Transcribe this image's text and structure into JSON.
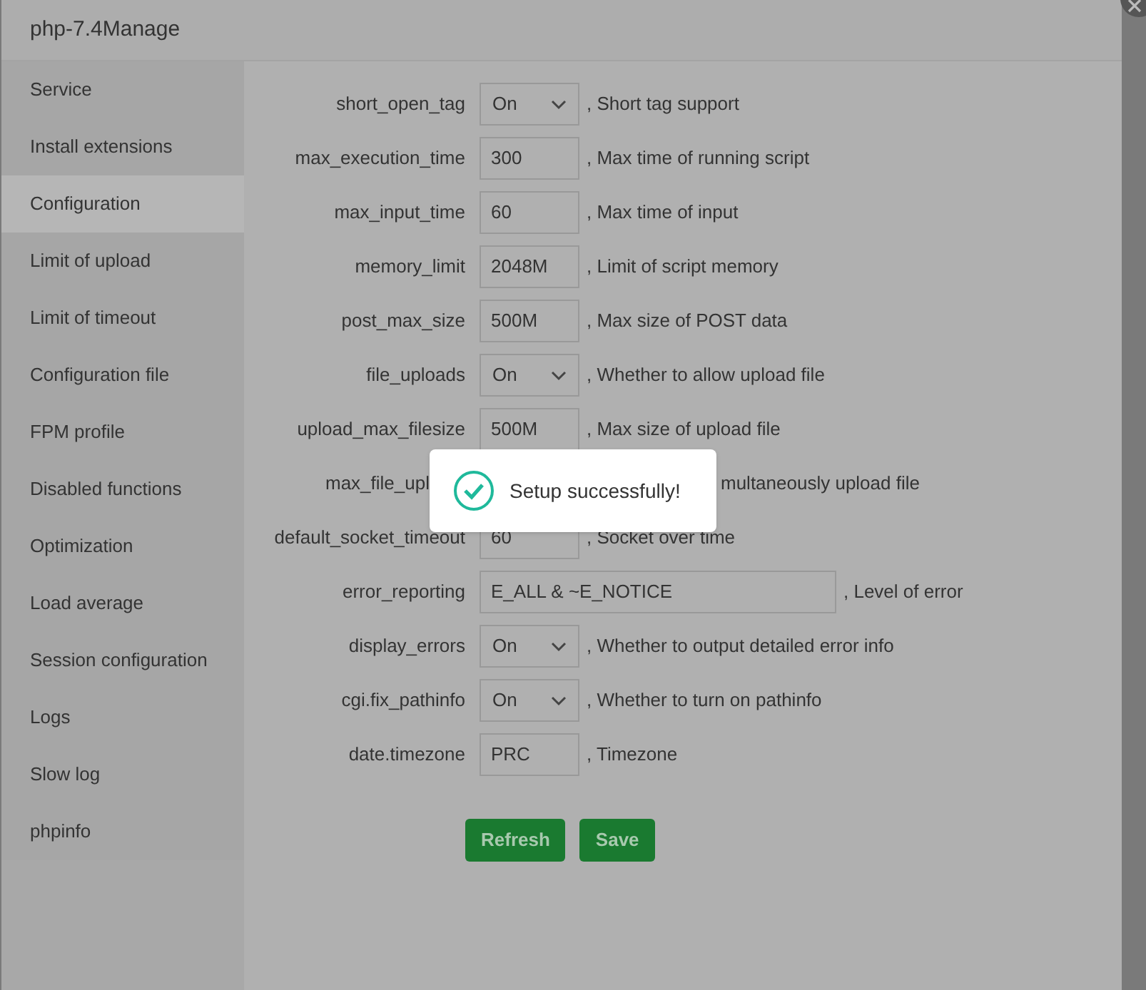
{
  "window": {
    "title": "php-7.4Manage"
  },
  "sidebar": {
    "items": [
      {
        "label": "Service",
        "selected": false
      },
      {
        "label": "Install extensions",
        "selected": false
      },
      {
        "label": "Configuration",
        "selected": true
      },
      {
        "label": "Limit of upload",
        "selected": false
      },
      {
        "label": "Limit of timeout",
        "selected": false
      },
      {
        "label": "Configuration file",
        "selected": false
      },
      {
        "label": "FPM profile",
        "selected": false
      },
      {
        "label": "Disabled functions",
        "selected": false
      },
      {
        "label": "Optimization",
        "selected": false
      },
      {
        "label": "Load average",
        "selected": false
      },
      {
        "label": "Session configuration",
        "selected": false
      },
      {
        "label": "Logs",
        "selected": false
      },
      {
        "label": "Slow log",
        "selected": false
      },
      {
        "label": "phpinfo",
        "selected": false
      }
    ]
  },
  "settings": [
    {
      "kind": "select",
      "label": "short_open_tag",
      "value": "On",
      "hint": ", Short tag support"
    },
    {
      "kind": "input",
      "label": "max_execution_time",
      "value": "300",
      "hint": ", Max time of running script"
    },
    {
      "kind": "input",
      "label": "max_input_time",
      "value": "60",
      "hint": ", Max time of input"
    },
    {
      "kind": "input",
      "label": "memory_limit",
      "value": "2048M",
      "hint": ", Limit of script memory"
    },
    {
      "kind": "input",
      "label": "post_max_size",
      "value": "500M",
      "hint": ", Max size of POST data"
    },
    {
      "kind": "select",
      "label": "file_uploads",
      "value": "On",
      "hint": ", Whether to allow upload file"
    },
    {
      "kind": "input",
      "label": "upload_max_filesize",
      "value": "500M",
      "hint": ", Max size of upload file"
    },
    {
      "kind": "covered",
      "label": "max_file_upl",
      "hint": "multaneously upload file"
    },
    {
      "kind": "input",
      "label": "default_socket_timeout",
      "value": "60",
      "hint": ", Socket over time"
    },
    {
      "kind": "wide",
      "label": "error_reporting",
      "value": "E_ALL & ~E_NOTICE",
      "hint": ", Level of error"
    },
    {
      "kind": "select",
      "label": "display_errors",
      "value": "On",
      "hint": ", Whether to output detailed error info"
    },
    {
      "kind": "select",
      "label": "cgi.fix_pathinfo",
      "value": "On",
      "hint": ", Whether to turn on pathinfo"
    },
    {
      "kind": "input",
      "label": "date.timezone",
      "value": "PRC",
      "hint": ", Timezone"
    }
  ],
  "buttons": [
    "Refresh",
    "Save"
  ],
  "toast": {
    "message": "Setup successfully!"
  }
}
